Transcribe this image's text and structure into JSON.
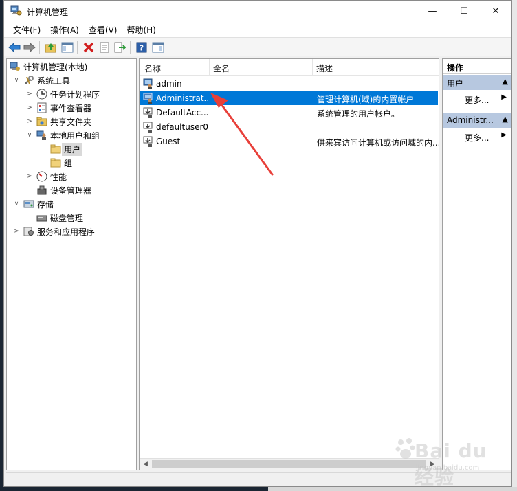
{
  "window": {
    "title": "计算机管理",
    "controls": {
      "minimize": "—",
      "maximize": "☐",
      "close": "✕"
    }
  },
  "menu": [
    "文件(F)",
    "操作(A)",
    "查看(V)",
    "帮助(H)"
  ],
  "tree": {
    "root": "计算机管理(本地)",
    "items": [
      {
        "label": "系统工具",
        "expander": "∨"
      },
      {
        "label": "任务计划程序",
        "expander": ">"
      },
      {
        "label": "事件查看器",
        "expander": ">"
      },
      {
        "label": "共享文件夹",
        "expander": ">"
      },
      {
        "label": "本地用户和组",
        "expander": "∨"
      },
      {
        "label": "用户",
        "expander": ""
      },
      {
        "label": "组",
        "expander": ""
      },
      {
        "label": "性能",
        "expander": ">"
      },
      {
        "label": "设备管理器",
        "expander": ""
      },
      {
        "label": "存储",
        "expander": "∨"
      },
      {
        "label": "磁盘管理",
        "expander": ""
      },
      {
        "label": "服务和应用程序",
        "expander": ">"
      }
    ]
  },
  "list": {
    "columns": [
      "名称",
      "全名",
      "描述"
    ],
    "rows": [
      {
        "name": "admin",
        "fullname": "",
        "desc": ""
      },
      {
        "name": "Administrat...",
        "fullname": "",
        "desc": "管理计算机(域)的内置帐户"
      },
      {
        "name": "DefaultAcc...",
        "fullname": "",
        "desc": "系统管理的用户帐户。"
      },
      {
        "name": "defaultuser0",
        "fullname": "",
        "desc": ""
      },
      {
        "name": "Guest",
        "fullname": "",
        "desc": "供来宾访问计算机或访问域的内..."
      }
    ],
    "selected_index": 1
  },
  "actions": {
    "title": "操作",
    "sections": [
      {
        "label": "用户",
        "more": "更多..."
      },
      {
        "label": "Administr...",
        "more": "更多..."
      }
    ]
  },
  "colors": {
    "selection": "#0078d7",
    "action_header": "#b7c8e0",
    "annotation_arrow": "#e8403a"
  },
  "watermark": {
    "brand": "Bai du 经验",
    "domain": "jingyan.baidu.com"
  }
}
